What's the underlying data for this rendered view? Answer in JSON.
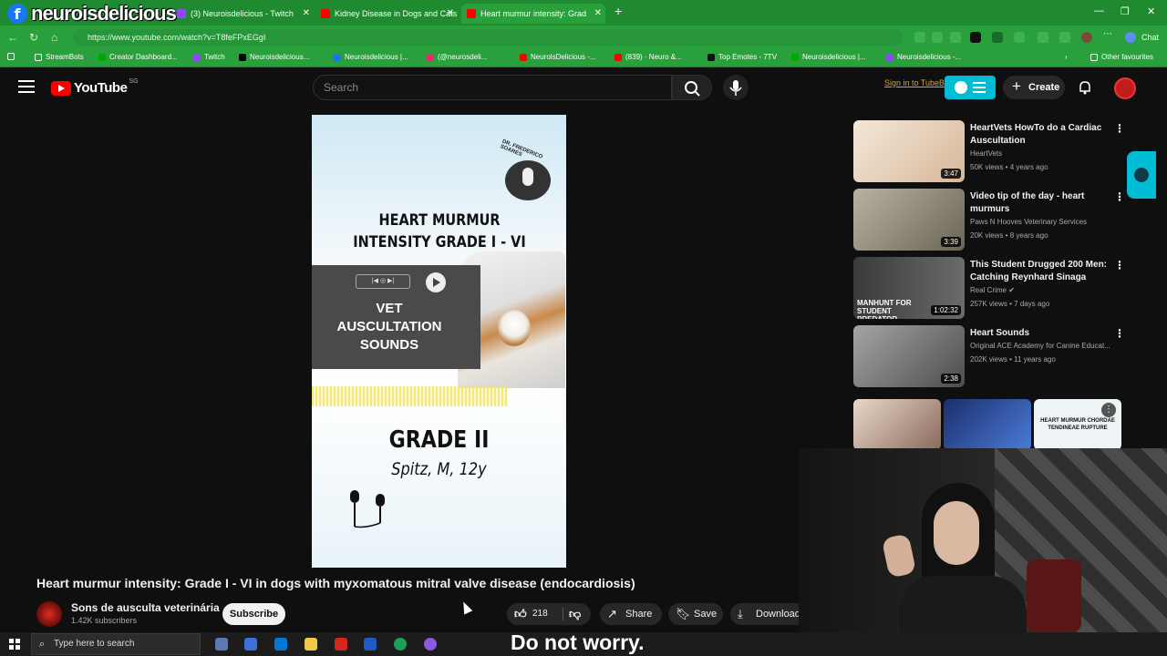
{
  "browser": {
    "streamer_logo": "neuroisdelicious",
    "tabs": [
      {
        "label": "(3) Neuroisdelicious - Twitch"
      },
      {
        "label": "Kidney Disease in Dogs and Cats:"
      },
      {
        "label": "Heart murmur intensity: Grad"
      }
    ],
    "url": "https://www.youtube.com/watch?v=T8feFPxEGgI",
    "bookmarks": [
      {
        "label": "StreamBots"
      },
      {
        "label": "Creator Dashboard..."
      },
      {
        "label": "Twitch"
      },
      {
        "label": "Neuroisdelicious..."
      },
      {
        "label": "Neuroisdelicious |..."
      },
      {
        "label": "(@neurosdeli..."
      },
      {
        "label": "NeurolsDelicious -..."
      },
      {
        "label": "(839) · Neuro &..."
      },
      {
        "label": "Top Emotes - 7TV"
      },
      {
        "label": "Neuroisdelicious |..."
      },
      {
        "label": "Neuroisdelicious -..."
      }
    ],
    "other_favourites": "Other favourites",
    "chat_label": "Chat"
  },
  "youtube": {
    "logo_word": "YouTube",
    "logo_country": "SG",
    "search_placeholder": "Search",
    "signin_tb": "Sign in to TubeBuddy",
    "create_label": "Create"
  },
  "video": {
    "overlay_title": "HEART MURMUR INTENSITY GRADE I - VI",
    "doctor_badge": "DR. FREDERICO SOARES",
    "player_label": "|◀ ◎ ▶|",
    "vet_label": "VET AUSCULTATION SOUNDS",
    "grade": "GRADE II",
    "dog_info": "Spitz, M, 12y",
    "title": "Heart murmur intensity: Grade I - VI in dogs with myxomatous mitral valve disease (endocardiosis)",
    "channel_name": "Sons de ausculta veterinária",
    "channel_subs": "1.42K subscribers",
    "subscribe_label": "Subscribe",
    "likes": "218",
    "share_label": "Share",
    "save_label": "Save",
    "download_label": "Download"
  },
  "recommendations": [
    {
      "title": "HeartVets HowTo do a Cardiac Auscultation",
      "channel": "HeartVets",
      "meta": "50K views • 4 years ago",
      "duration": "3:47",
      "thumb_color": "#e9dcc8"
    },
    {
      "title": "Video tip of the day - heart murmurs",
      "channel": "Paws N Hooves Veterinary Services",
      "meta": "20K views • 8 years ago",
      "duration": "3:39",
      "thumb_color": "#c9c3b5"
    },
    {
      "title": "This Student Drugged 200 Men: Catching Reynhard Sinaga",
      "channel": "Real Crime",
      "meta": "257K views • 7 days ago",
      "duration": "1:02:32",
      "thumb_color": "#5a5a5a",
      "thumb_caption": "MANHUNT FOR STUDENT PREDATOR"
    },
    {
      "title": "Heart Sounds",
      "channel": "Original ACE Academy for Canine Educat...",
      "meta": "202K views • 11 years ago",
      "duration": "2:38",
      "thumb_color": "#8c8c8c"
    }
  ],
  "shorts": [
    {
      "thumb_color": "#c7b2a6"
    },
    {
      "thumb_color": "#3b5aa8"
    },
    {
      "caption": "HEART MURMUR CHORDAE TENDINEAE RUPTURE",
      "thumb_color": "#eef3f6"
    }
  ],
  "taskbar": {
    "search_placeholder": "Type here to search"
  },
  "caption_text": "Do not worry."
}
